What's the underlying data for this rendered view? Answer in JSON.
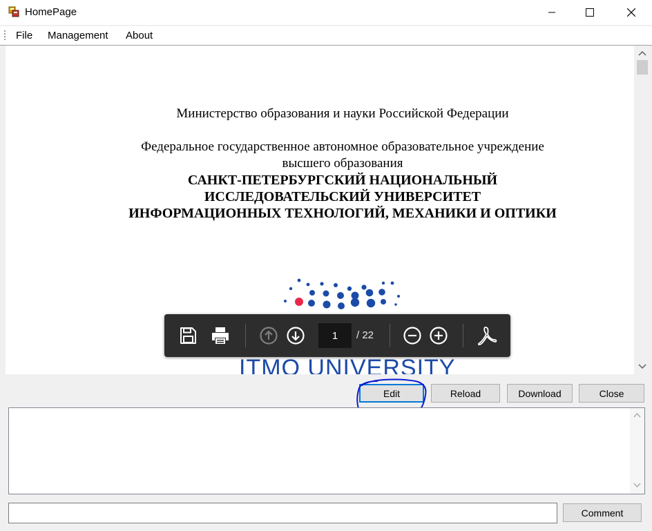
{
  "window": {
    "title": "HomePage",
    "icon": "windows-forms-app-icon",
    "controls": [
      "minimize-icon",
      "maximize-icon",
      "close-icon"
    ]
  },
  "menu": {
    "items": [
      {
        "label": "File"
      },
      {
        "label": "Management"
      },
      {
        "label": "About"
      }
    ]
  },
  "document": {
    "lines": [
      "Министерство образования и науки Российской Федерации",
      "Федеральное государственное автономное образовательное учреждение",
      "высшего образования",
      "САНКТ-ПЕТЕРБУРГСКИЙ НАЦИОНАЛЬНЫЙ",
      "ИССЛЕДОВАТЕЛЬСКИЙ УНИВЕРСИТЕТ",
      "ИНФОРМАЦИОННЫХ ТЕХНОЛОГИЙ, МЕХАНИКИ И ОПТИКИ"
    ],
    "logo_text": "ITMO UNIVERSITY",
    "logo_colors": {
      "dots": "#1c4aa8",
      "accent": "#e8284a"
    }
  },
  "pdf_toolbar": {
    "current_page": "1",
    "total_pages": "/ 22",
    "icons": [
      "save-icon",
      "print-icon",
      "page-up-icon",
      "page-down-icon",
      "zoom-out-icon",
      "zoom-in-icon",
      "acrobat-icon"
    ]
  },
  "actions": {
    "edit": "Edit",
    "reload": "Reload",
    "download": "Download",
    "close": "Close"
  },
  "log": {
    "value": ""
  },
  "comment": {
    "value": "",
    "button": "Comment"
  },
  "colors": {
    "focus": "#0078d7",
    "annotation": "#0a1bd4"
  }
}
